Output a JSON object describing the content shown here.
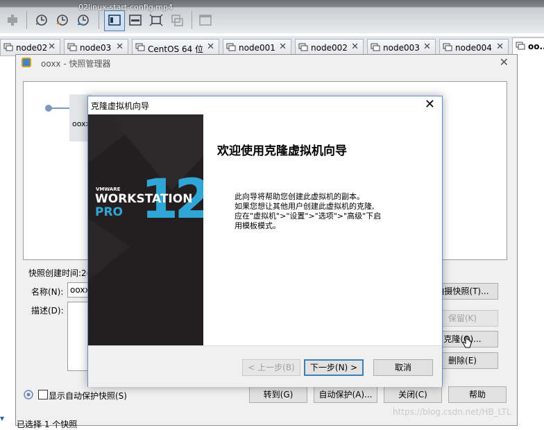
{
  "video_title": "02linux-start-config.mp4",
  "toolbar": {
    "icons": [
      "power-icon",
      "snapshot-take-icon",
      "snapshot-revert-icon",
      "snapshot-manager-icon",
      "console-view-icon",
      "hide-toolbar-icon",
      "fullscreen-icon",
      "unity-icon",
      "thumbnail-icon"
    ]
  },
  "tabs": [
    {
      "label": "node02"
    },
    {
      "label": "node03"
    },
    {
      "label": "CentOS 64 位"
    },
    {
      "label": "node001"
    },
    {
      "label": "node002"
    },
    {
      "label": "node003"
    },
    {
      "label": "node004"
    },
    {
      "label": "oo..."
    }
  ],
  "snapshot_manager": {
    "title": "ooxx - 快照管理器",
    "tree_node_label": "ooxx",
    "created_time_label": "快照创建时间:2(",
    "name_label": "名称(N):",
    "name_value": "ooxx",
    "desc_label": "描述(D):",
    "take_snapshot_button": "拍摄快照(T)...",
    "keep_button": "保留(K)",
    "clone_button": "克隆(O)...",
    "delete_button": "删除(E)",
    "auto_protect_checkbox": "显示自动保护快照(S)",
    "goto_button": "转到(G)",
    "auto_protect_button": "自动保护(A)...",
    "close_button": "关闭(C)",
    "help_button": "帮助"
  },
  "wizard": {
    "title": "克隆虚拟机向导",
    "banner": {
      "brand": "VMWARE",
      "product": "WORKSTATION",
      "edition": "PRO",
      "version": "12"
    },
    "heading": "欢迎使用克隆虚拟机向导",
    "desc_lines": [
      "此向导将帮助您创建此虚拟机的副本。",
      "如果您想让其他用户创建此虚拟机的克隆,",
      "应在\"虚拟机\">\"设置\">\"选项\">\"高级\"下启",
      "用模板模式。"
    ],
    "back_button": "< 上一步(B)",
    "next_button": "下一步(N) >",
    "cancel_button": "取消"
  },
  "status_text": "已选择 1 个快照",
  "watermark": "https://blog.csdn.net/HB_LTL",
  "colors": {
    "vmware_blue": "#2fa6d6",
    "banner_bg": "#231f20",
    "focus_border": "#3c7fb1"
  }
}
